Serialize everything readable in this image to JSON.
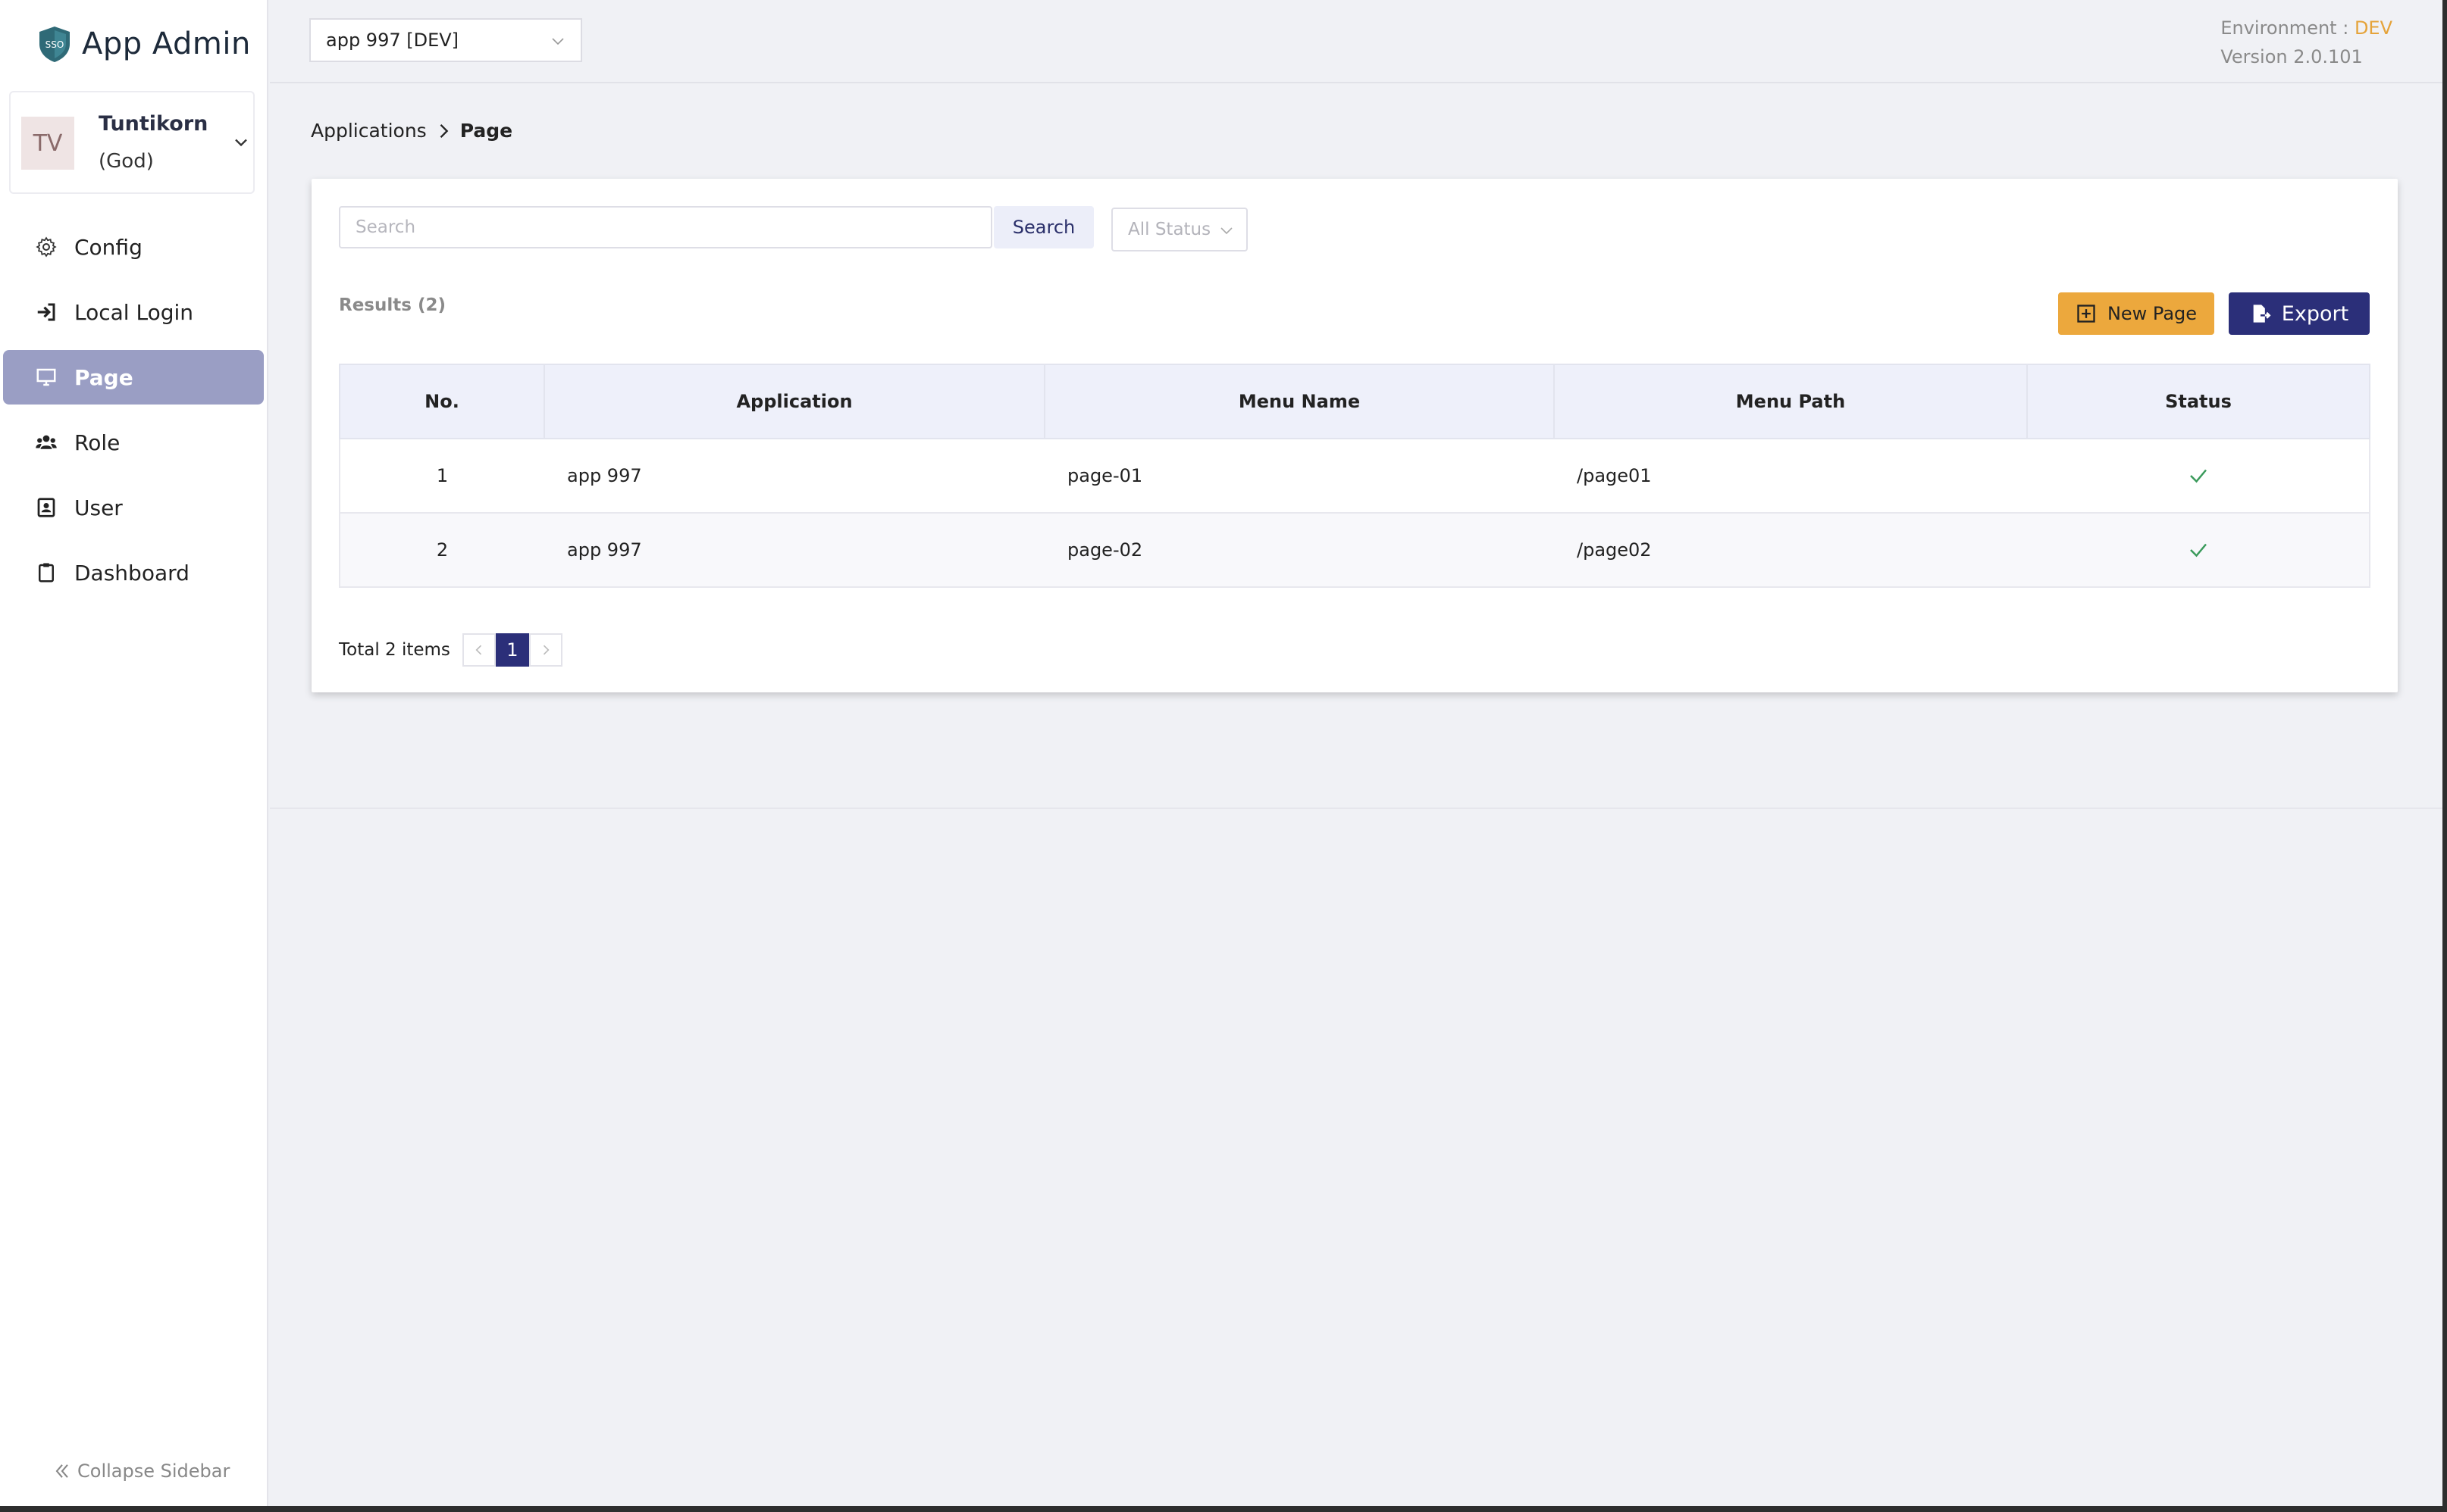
{
  "brand": {
    "name": "App Admin",
    "logo_text": "SSO",
    "logo_color": "#2f6a77"
  },
  "user": {
    "initials": "TV",
    "name": "Tuntikorn",
    "role": "(God)"
  },
  "sidebar": {
    "items": [
      {
        "label": "Config",
        "icon": "gear-icon"
      },
      {
        "label": "Local Login",
        "icon": "sign-in-icon"
      },
      {
        "label": "Page",
        "icon": "monitor-icon",
        "active": true
      },
      {
        "label": "Role",
        "icon": "users-icon"
      },
      {
        "label": "User",
        "icon": "contact-card-icon"
      },
      {
        "label": "Dashboard",
        "icon": "clipboard-icon"
      }
    ],
    "collapse_label": "Collapse Sidebar"
  },
  "header": {
    "app_select_value": "app 997 [DEV]",
    "env_label": "Environment :",
    "env_value": "DEV",
    "version": "Version 2.0.101"
  },
  "breadcrumb": {
    "parent": "Applications",
    "current": "Page"
  },
  "filters": {
    "search_placeholder": "Search",
    "search_button": "Search",
    "status_value": "All Status"
  },
  "results_label": "Results (2)",
  "actions": {
    "new_label": "New Page",
    "export_label": "Export"
  },
  "table": {
    "columns": [
      "No.",
      "Application",
      "Menu Name",
      "Menu Path",
      "Status"
    ],
    "rows": [
      {
        "no": "1",
        "application": "app 997",
        "menu_name": "page-01",
        "menu_path": "/page01",
        "status": "active"
      },
      {
        "no": "2",
        "application": "app 997",
        "menu_name": "page-02",
        "menu_path": "/page02",
        "status": "active"
      }
    ]
  },
  "pagination": {
    "total_label": "Total 2 items",
    "current_page": "1"
  },
  "colors": {
    "accent": "#2b2f79",
    "new_button": "#eca83d",
    "active_nav": "#9a9ec4",
    "env_dev": "#e5a33a",
    "check": "#3a9a5b"
  }
}
